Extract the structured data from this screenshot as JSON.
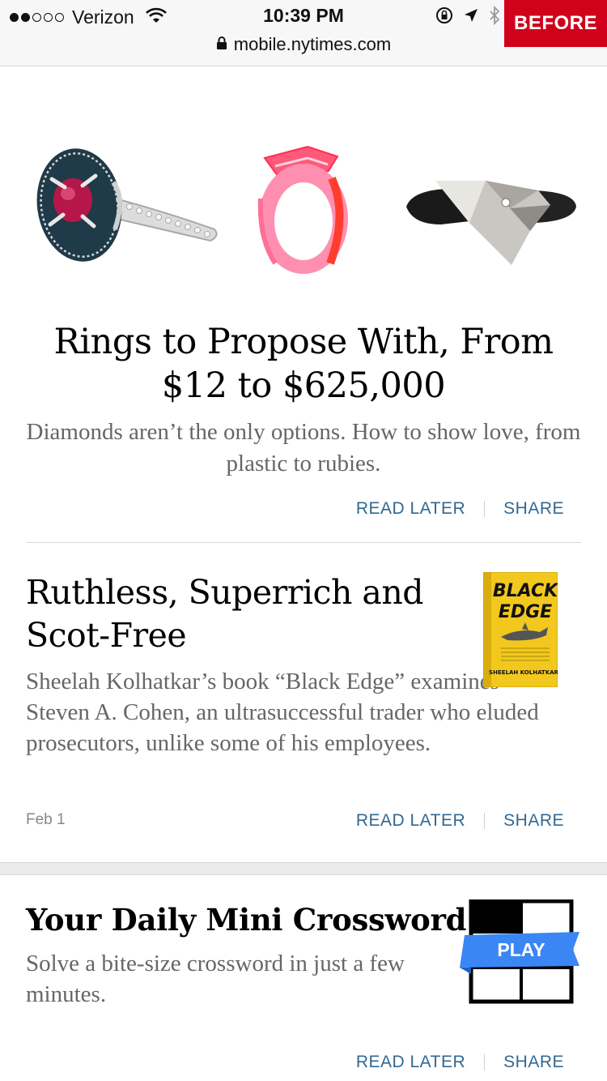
{
  "status_bar": {
    "carrier": "Verizon",
    "time": "10:39 PM",
    "url": "mobile.nytimes.com",
    "badge": "BEFORE"
  },
  "articles": [
    {
      "headline": "Rings to Propose With, From $12 to $625,000",
      "summary": "Diamonds aren’t the only options. How to show love, from plastic to rubies.",
      "read_later": "READ LATER",
      "share": "SHARE"
    },
    {
      "headline": "Ruthless, Superrich and Scot-Free",
      "summary": "Sheelah Kolhatkar’s book “Black Edge” examines Steven A. Cohen, an ultrasuccessful trader who eluded prosecutors, unlike some of his employees.",
      "date": "Feb 1",
      "read_later": "READ LATER",
      "share": "SHARE",
      "book_cover": {
        "title_line1": "BLACK",
        "title_line2": "EDGE",
        "author": "SHEELAH KOLHATKAR"
      }
    },
    {
      "headline": "Your Daily Mini Crossword",
      "summary": "Solve a bite-size crossword in just a few minutes.",
      "play_label": "PLAY",
      "read_later": "READ LATER",
      "share": "SHARE"
    }
  ],
  "colors": {
    "link": "#326891",
    "badge": "#d0021b",
    "play_ribbon": "#3a86f5",
    "book_yellow": "#f2c81e"
  },
  "icons": [
    "wifi-icon",
    "lock-icon",
    "orientation-lock-icon",
    "location-icon",
    "bluetooth-icon"
  ]
}
